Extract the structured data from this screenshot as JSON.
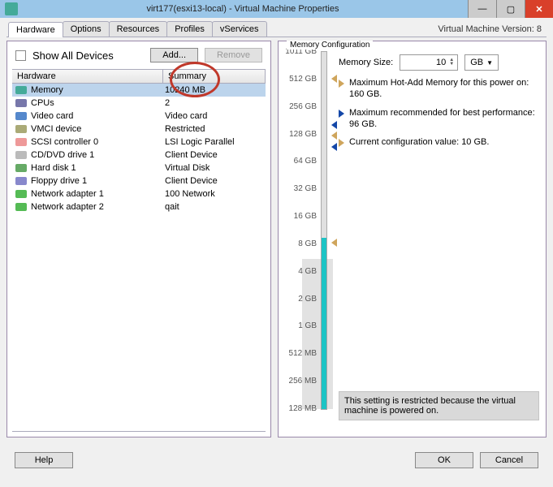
{
  "title": "virt177(esxi13-local) - Virtual Machine Properties",
  "version_text": "Virtual Machine Version: 8",
  "tabs": [
    "Hardware",
    "Options",
    "Resources",
    "Profiles",
    "vServices"
  ],
  "active_tab": 0,
  "show_all_label": "Show All Devices",
  "add_label": "Add...",
  "remove_label": "Remove",
  "list_headers": {
    "hw": "Hardware",
    "sum": "Summary"
  },
  "rows": [
    {
      "icon": "memory-icon",
      "hw": "Memory",
      "sum": "10240 MB",
      "selected": true
    },
    {
      "icon": "cpu-icon",
      "hw": "CPUs",
      "sum": "2"
    },
    {
      "icon": "video-icon",
      "hw": "Video card",
      "sum": "Video card"
    },
    {
      "icon": "vmci-icon",
      "hw": "VMCI device",
      "sum": "Restricted"
    },
    {
      "icon": "scsi-icon",
      "hw": "SCSI controller 0",
      "sum": "LSI Logic Parallel"
    },
    {
      "icon": "cd-icon",
      "hw": "CD/DVD drive 1",
      "sum": "Client Device"
    },
    {
      "icon": "disk-icon",
      "hw": "Hard disk 1",
      "sum": "Virtual Disk"
    },
    {
      "icon": "floppy-icon",
      "hw": "Floppy drive 1",
      "sum": "Client Device"
    },
    {
      "icon": "nic-icon",
      "hw": "Network adapter 1",
      "sum": "100 Network"
    },
    {
      "icon": "nic-icon",
      "hw": "Network adapter 2",
      "sum": "qait"
    }
  ],
  "memcfg": {
    "title": "Memory Configuration",
    "size_label": "Memory Size:",
    "size_value": "10",
    "size_unit": "GB",
    "ticks": [
      "1011 GB",
      "512 GB",
      "256 GB",
      "128 GB",
      "64 GB",
      "32 GB",
      "16 GB",
      "8 GB",
      "4 GB",
      "2 GB",
      "1 GB",
      "512 MB",
      "256 MB",
      "128 MB"
    ],
    "info_max": "Maximum Hot-Add Memory for this power on: 160 GB.",
    "info_rec": "Maximum recommended for best performance: 96 GB.",
    "info_cur": "Current configuration value: 10 GB.",
    "restricted": "This setting is restricted because the virtual machine is powered on."
  },
  "footer": {
    "help": "Help",
    "ok": "OK",
    "cancel": "Cancel"
  }
}
